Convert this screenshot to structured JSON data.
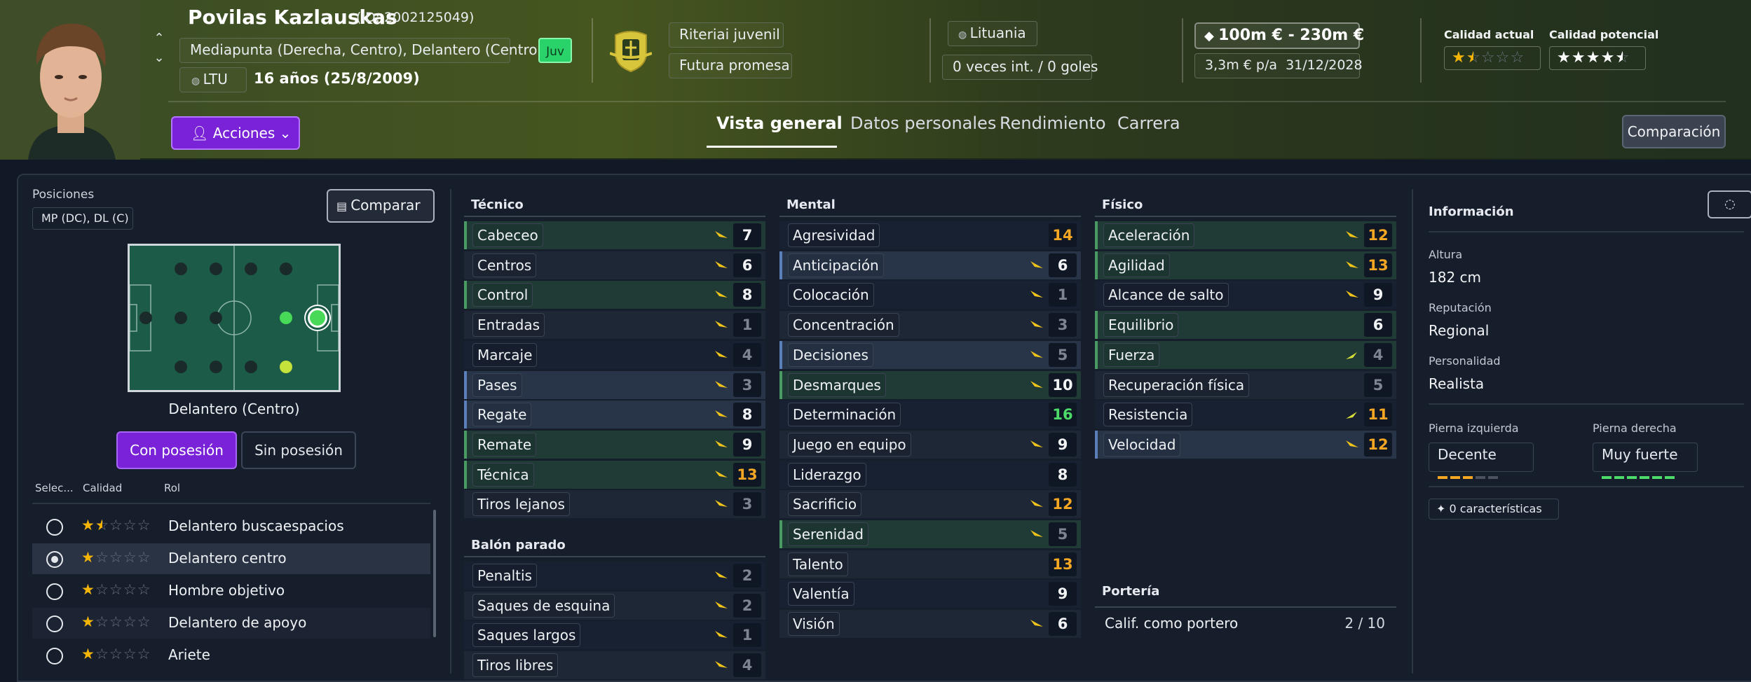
{
  "header": {
    "name": "Povilas Kazlauskas",
    "id_text": "(ID: 2002125049)",
    "positions": "Mediapunta (Derecha, Centro), Delantero (Centro)",
    "nation_code": "LTU",
    "age": "16 años (25/8/2009)",
    "youth_badge": "Juv",
    "club_team": "Riteriai juvenil",
    "status": "Futura promesa",
    "nationality": "Lituania",
    "intl": "0 veces int. / 0 goles",
    "value": "100m € - 230m €",
    "wage": "3,3m € p/a",
    "contract_end": "31/12/2028",
    "current_quality_label": "Calidad actual",
    "potential_quality_label": "Calidad potencial",
    "current_quality_stars": 1.5,
    "potential_quality_stars": 4.5,
    "actions_label": "Acciones",
    "tabs": [
      "Vista general",
      "Datos personales",
      "Rendimiento",
      "Carrera"
    ],
    "compare_label": "Comparación"
  },
  "left": {
    "positions_label": "Posiciones",
    "positions_chip": "MP (DC), DL (C)",
    "compare_button": "Comparar",
    "selected_position": "Delantero (Centro)",
    "possession_tabs": [
      "Con posesión",
      "Sin posesión"
    ],
    "columns": [
      "Selec...",
      "Calidad",
      "Rol"
    ],
    "roles": [
      {
        "name": "Delantero buscaespacios",
        "stars": 1.5,
        "selected": false
      },
      {
        "name": "Delantero centro",
        "stars": 1,
        "selected": true
      },
      {
        "name": "Hombre objetivo",
        "stars": 1,
        "selected": false
      },
      {
        "name": "Delantero de apoyo",
        "stars": 1,
        "selected": false
      },
      {
        "name": "Ariete",
        "stars": 1,
        "selected": false
      }
    ]
  },
  "attributes": {
    "tecnico_title": "Técnico",
    "tecnico": [
      {
        "name": "Cabeceo",
        "value": "7",
        "hl": "gr"
      },
      {
        "name": "Centros",
        "value": "6",
        "hl": ""
      },
      {
        "name": "Control",
        "value": "8",
        "hl": "gr"
      },
      {
        "name": "Entradas",
        "value": "1",
        "hl": ""
      },
      {
        "name": "Marcaje",
        "value": "4",
        "hl": ""
      },
      {
        "name": "Pases",
        "value": "3",
        "hl": "bl"
      },
      {
        "name": "Regate",
        "value": "8",
        "hl": "bl"
      },
      {
        "name": "Remate",
        "value": "9",
        "hl": "gr"
      },
      {
        "name": "Técnica",
        "value": "13",
        "hl": "gr"
      },
      {
        "name": "Tiros lejanos",
        "value": "3",
        "hl": ""
      }
    ],
    "balon_title": "Balón parado",
    "balon": [
      {
        "name": "Penaltis",
        "value": "2",
        "hl": ""
      },
      {
        "name": "Saques de esquina",
        "value": "2",
        "hl": ""
      },
      {
        "name": "Saques largos",
        "value": "1",
        "hl": ""
      },
      {
        "name": "Tiros libres",
        "value": "4",
        "hl": ""
      }
    ],
    "mental_title": "Mental",
    "mental": [
      {
        "name": "Agresividad",
        "value": "14",
        "hl": ""
      },
      {
        "name": "Anticipación",
        "value": "6",
        "hl": "bl"
      },
      {
        "name": "Colocación",
        "value": "1",
        "hl": ""
      },
      {
        "name": "Concentración",
        "value": "3",
        "hl": ""
      },
      {
        "name": "Decisiones",
        "value": "5",
        "hl": "bl"
      },
      {
        "name": "Desmarques",
        "value": "10",
        "hl": "gr"
      },
      {
        "name": "Determinación",
        "value": "16",
        "hl": ""
      },
      {
        "name": "Juego en equipo",
        "value": "9",
        "hl": ""
      },
      {
        "name": "Liderazgo",
        "value": "8",
        "hl": ""
      },
      {
        "name": "Sacrificio",
        "value": "12",
        "hl": ""
      },
      {
        "name": "Serenidad",
        "value": "5",
        "hl": "gr"
      },
      {
        "name": "Talento",
        "value": "13",
        "hl": ""
      },
      {
        "name": "Valentía",
        "value": "9",
        "hl": ""
      },
      {
        "name": "Visión",
        "value": "6",
        "hl": ""
      }
    ],
    "fisico_title": "Físico",
    "fisico": [
      {
        "name": "Aceleración",
        "value": "12",
        "hl": "gr"
      },
      {
        "name": "Agilidad",
        "value": "13",
        "hl": "gr"
      },
      {
        "name": "Alcance de salto",
        "value": "9",
        "hl": ""
      },
      {
        "name": "Equilibrio",
        "value": "6",
        "hl": "gr"
      },
      {
        "name": "Fuerza",
        "value": "4",
        "hl": "gr"
      },
      {
        "name": "Recuperación física",
        "value": "5",
        "hl": ""
      },
      {
        "name": "Resistencia",
        "value": "11",
        "hl": ""
      },
      {
        "name": "Velocidad",
        "value": "12",
        "hl": "bl"
      }
    ],
    "porteria_title": "Portería",
    "gk_label": "Calif. como portero",
    "gk_value": "2 / 10"
  },
  "info": {
    "title": "Información",
    "height_label": "Altura",
    "height": "182 cm",
    "reputation_label": "Reputación",
    "reputation": "Regional",
    "personality_label": "Personalidad",
    "personality": "Realista",
    "left_foot_label": "Pierna izquierda",
    "left_foot": "Decente",
    "right_foot_label": "Pierna derecha",
    "right_foot": "Muy fuerte",
    "traits": "0 características"
  },
  "colors": {
    "accent": "#7a22d8",
    "good": "#2ad26a",
    "orange": "#f5a623",
    "green": "#4ddc6a",
    "grey": "#7d8593"
  }
}
